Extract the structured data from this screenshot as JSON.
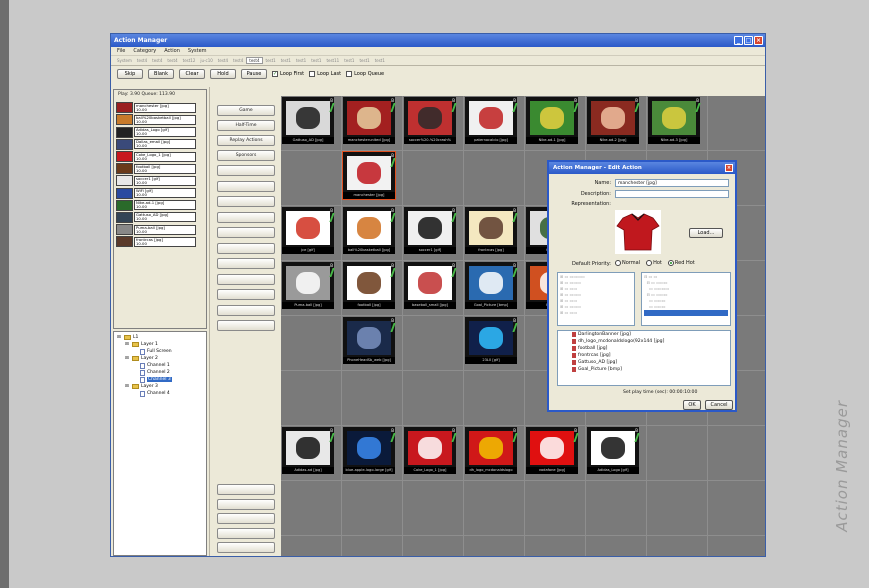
{
  "caption": "Action Manager",
  "window": {
    "title": "Action Manager"
  },
  "menu": [
    "File",
    "Category",
    "Action",
    "System"
  ],
  "tabs": [
    {
      "label": "System",
      "active": false
    },
    {
      "label": "test4",
      "active": false
    },
    {
      "label": "test4",
      "active": false
    },
    {
      "label": "test4",
      "active": false
    },
    {
      "label": "test12",
      "active": false
    },
    {
      "label": "ju-c10",
      "active": false
    },
    {
      "label": "test4",
      "active": false
    },
    {
      "label": "test4",
      "active": false
    },
    {
      "label": "test4",
      "active": true
    },
    {
      "label": "test1",
      "active": false
    },
    {
      "label": "test1",
      "active": false
    },
    {
      "label": "test1",
      "active": false
    },
    {
      "label": "test1",
      "active": false
    },
    {
      "label": "test11",
      "active": false
    },
    {
      "label": "test1",
      "active": false
    },
    {
      "label": "test1",
      "active": false
    },
    {
      "label": "test1",
      "active": false
    }
  ],
  "toolbar": {
    "buttons": [
      "Skip",
      "Blank",
      "Clear",
      "Hold",
      "Pause"
    ],
    "loop_first": "Loop First",
    "loop_last": "Loop Last",
    "loop_queue": "Loop Queue"
  },
  "player": {
    "status": "Play:   3.90 Queue:  113.90"
  },
  "queue": [
    {
      "name": "manchester [jpg]",
      "time": "10.00",
      "color": "#9a1f1f"
    },
    {
      "name": "ball%20basketball [jpg]",
      "time": "10.00",
      "color": "#c77a2a"
    },
    {
      "name": "Adidas_Logo [gif]",
      "time": "10.00",
      "color": "#222222"
    },
    {
      "name": "Dallas_email [jpg]",
      "time": "10.00",
      "color": "#3a4a7a"
    },
    {
      "name": "Coke_Logo_1 [jpg]",
      "time": "10.00",
      "color": "#c8181e"
    },
    {
      "name": "football [jpg]",
      "time": "10.00",
      "color": "#6a3a1a"
    },
    {
      "name": "soccer1 [gif]",
      "time": "10.00",
      "color": "#e8e8e8"
    },
    {
      "name": "WiFi [gif]",
      "time": "10.00",
      "color": "#2a4aa0"
    },
    {
      "name": "Nike-ad-1 [jpg]",
      "time": "10.00",
      "color": "#2a6a2a"
    },
    {
      "name": "Gattuso_AD [jpg]",
      "time": "10.00",
      "color": "#334455"
    },
    {
      "name": "Puma-ball [jpg]",
      "time": "10.00",
      "color": "#888888"
    },
    {
      "name": "frontrcas [jpg]",
      "time": "10.00",
      "color": "#5a3a2a"
    }
  ],
  "tree": [
    {
      "label": "L1",
      "kind": "root",
      "indent": 0
    },
    {
      "label": "Layer 1",
      "kind": "folder",
      "indent": 1
    },
    {
      "label": "Full Screen",
      "kind": "doc",
      "indent": 2
    },
    {
      "label": "Layer 2",
      "kind": "folder",
      "indent": 1
    },
    {
      "label": "Channel 1",
      "kind": "doc",
      "indent": 2
    },
    {
      "label": "Channel 2",
      "kind": "doc",
      "indent": 2
    },
    {
      "label": "Channel 3",
      "kind": "doc",
      "indent": 2,
      "selected": true
    },
    {
      "label": "Layer 3",
      "kind": "folder",
      "indent": 1
    },
    {
      "label": "Channel 4",
      "kind": "doc",
      "indent": 2
    }
  ],
  "categories": [
    "Game",
    "Half-Time",
    "Replay Actions",
    "Sponsors"
  ],
  "tiles": [
    {
      "row": 0,
      "col": 0,
      "caption": "Gattuso_AD [jpg]",
      "bg": "#d9d9d9",
      "fg": "#1a1a1a"
    },
    {
      "row": 0,
      "col": 1,
      "caption": "manchesterunited [jpg]",
      "bg": "#a32020",
      "fg": "#e8d0a0"
    },
    {
      "row": 0,
      "col": 2,
      "caption": "soccer%20-%20crash%",
      "bg": "#bf3030",
      "fg": "#2a2a2a"
    },
    {
      "row": 0,
      "col": 3,
      "caption": "paternocalcio [jpg]",
      "bg": "#f0f0f0",
      "fg": "#c02020"
    },
    {
      "row": 0,
      "col": 4,
      "caption": "Nike-ad-1 [jpg]",
      "bg": "#3a8a30",
      "fg": "#e8d040"
    },
    {
      "row": 0,
      "col": 5,
      "caption": "Nike-ad-2 [jpg]",
      "bg": "#8a2a20",
      "fg": "#f0c0a0"
    },
    {
      "row": 0,
      "col": 6,
      "caption": "Nike-ad-3 [jpg]",
      "bg": "#4a8a3a",
      "fg": "#e0d040"
    },
    {
      "row": 1,
      "col": 1,
      "caption": "manchester [jpg]",
      "bg": "#f2f2f2",
      "fg": "#c0181e",
      "selected": true
    },
    {
      "row": 2,
      "col": 0,
      "caption": "jce [gif]",
      "bg": "#ffffff",
      "fg": "#d03020"
    },
    {
      "row": 2,
      "col": 1,
      "caption": "ball%20basketball [jpg]",
      "bg": "#ffffff",
      "fg": "#d07020"
    },
    {
      "row": 2,
      "col": 2,
      "caption": "soccer1 [gif]",
      "bg": "#f0f0f0",
      "fg": "#111111"
    },
    {
      "row": 2,
      "col": 3,
      "caption": "frontrcas [jpg]",
      "bg": "#f4e8c0",
      "fg": "#5a3a2a"
    },
    {
      "row": 2,
      "col": 4,
      "caption": "Corner",
      "bg": "#e0e0e0",
      "fg": "#2a5a2a"
    },
    {
      "row": 3,
      "col": 0,
      "caption": "Puma-ball [jpg]",
      "bg": "#9a9a9a",
      "fg": "#ffffff"
    },
    {
      "row": 3,
      "col": 1,
      "caption": "football [jpg]",
      "bg": "#ffffff",
      "fg": "#6a3a1a"
    },
    {
      "row": 3,
      "col": 2,
      "caption": "baseball_small [jpg]",
      "bg": "#ffffff",
      "fg": "#c03030"
    },
    {
      "row": 3,
      "col": 3,
      "caption": "Goal_Picture [bmp]",
      "bg": "#2a6ab0",
      "fg": "#ffffff"
    },
    {
      "row": 3,
      "col": 4,
      "caption": "Hot-Pe",
      "bg": "#d05020",
      "fg": "#ffffff"
    },
    {
      "row": 4,
      "col": 1,
      "caption": "PhoneHeadSb_web [jpg]",
      "bg": "#1a2a4a",
      "fg": "#7a90c0"
    },
    {
      "row": 4,
      "col": 3,
      "caption": "23L0 [gif]",
      "bg": "#10204a",
      "fg": "#30c0ff"
    },
    {
      "row": 6,
      "col": 0,
      "caption": "Adidas-ad [jpg]",
      "bg": "#e8e8e8",
      "fg": "#111111"
    },
    {
      "row": 6,
      "col": 1,
      "caption": "blue-apple-logo-large [gif]",
      "bg": "#0a1a3a",
      "fg": "#3a8af0"
    },
    {
      "row": 6,
      "col": 2,
      "caption": "Coke_Logo_1 [jpg]",
      "bg": "#c8181e",
      "fg": "#ffffff"
    },
    {
      "row": 6,
      "col": 3,
      "caption": "dh_logo_mcdonaldslogo",
      "bg": "#d01818",
      "fg": "#f2c200"
    },
    {
      "row": 6,
      "col": 4,
      "caption": "vodafone [jpg]",
      "bg": "#e01010",
      "fg": "#ffffff"
    },
    {
      "row": 6,
      "col": 5,
      "caption": "Adidas_Logo [gif]",
      "bg": "#ffffff",
      "fg": "#111111"
    }
  ],
  "dialog": {
    "title": "Action Manager - Edit Action",
    "name_label": "Name:",
    "name_value": "manchester [jpg]",
    "description_label": "Description:",
    "description_value": "",
    "representation_label": "Representation:",
    "load_button": "Load...",
    "priority_label": "Default Priority:",
    "priorities": [
      {
        "label": "Normal",
        "selected": false
      },
      {
        "label": "Hot",
        "selected": false
      },
      {
        "label": "Red Hot",
        "selected": true
      }
    ],
    "files": [
      "DarlingtonBanner [jpg]",
      "dh_logo_mcdonaldslogo(92x144 [jpg]",
      "football [jpg]",
      "frontrcas [jpg]",
      "Gattuso_AD [jpg]",
      "Goal_Picture [bmp]"
    ],
    "play_time_label": "Set play time (sec): 00:00:10:00",
    "ok": "OK",
    "cancel": "Cancel"
  }
}
